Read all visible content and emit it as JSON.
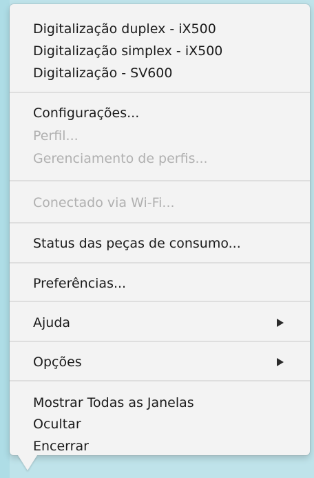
{
  "menu": {
    "scan_items": [
      "Digitalização duplex - iX500",
      "Digitalização simplex - iX500",
      "Digitalização - SV600"
    ],
    "config_items": [
      {
        "label": "Configurações...",
        "enabled": true
      },
      {
        "label": "Perfil...",
        "enabled": false
      },
      {
        "label": "Gerenciamento de perfis...",
        "enabled": false
      }
    ],
    "connection": {
      "label": "Conectado via Wi-Fi...",
      "enabled": false
    },
    "consumables": {
      "label": "Status das peças de consumo..."
    },
    "preferences": {
      "label": "Preferências..."
    },
    "help": {
      "label": "Ajuda",
      "submenu_icon": "triangle-right-icon"
    },
    "options": {
      "label": "Opções",
      "submenu_icon": "triangle-right-icon"
    },
    "window_items": [
      "Mostrar Todas as Janelas",
      "Ocultar",
      "Encerrar"
    ]
  }
}
